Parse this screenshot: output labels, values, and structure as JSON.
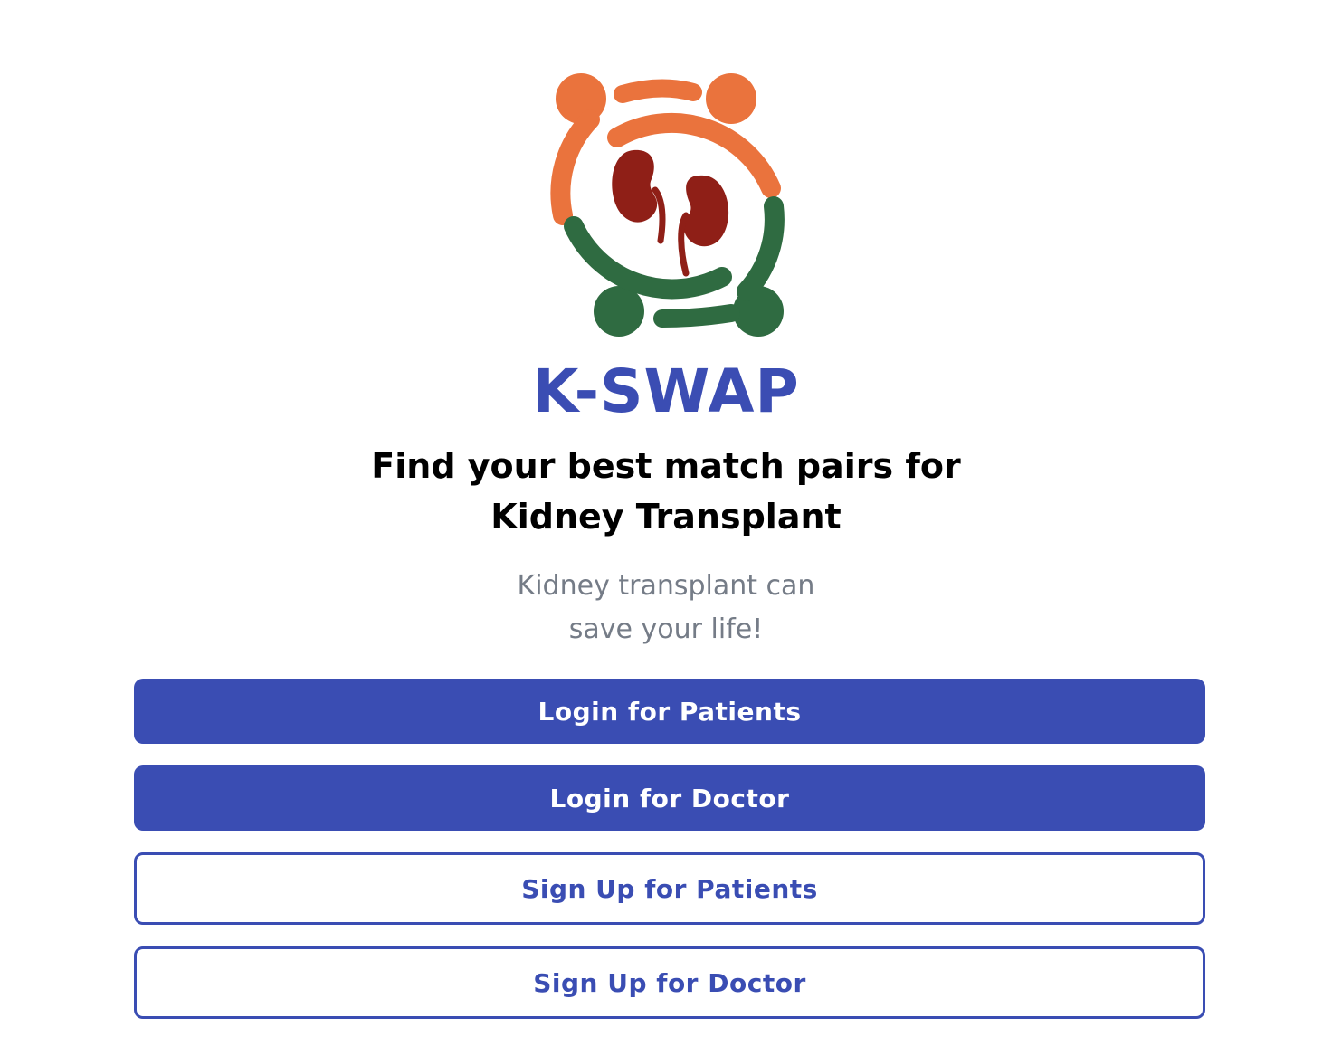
{
  "brand": {
    "name": "K-SWAP",
    "logo_icon": "kidney-exchange-logo-icon",
    "colors": {
      "primary": "#3a4db3",
      "orange": "#ea733d",
      "green": "#2f6b41",
      "kidney": "#8f1f17"
    }
  },
  "hero": {
    "headline_line1": "Find your best match pairs for",
    "headline_line2": "Kidney Transplant",
    "subtext_line1": "Kidney transplant can",
    "subtext_line2": "save your life!"
  },
  "actions": {
    "login_patients": "Login for Patients",
    "login_doctor": "Login for Doctor",
    "signup_patients": "Sign Up for Patients",
    "signup_doctor": "Sign Up for Doctor"
  }
}
